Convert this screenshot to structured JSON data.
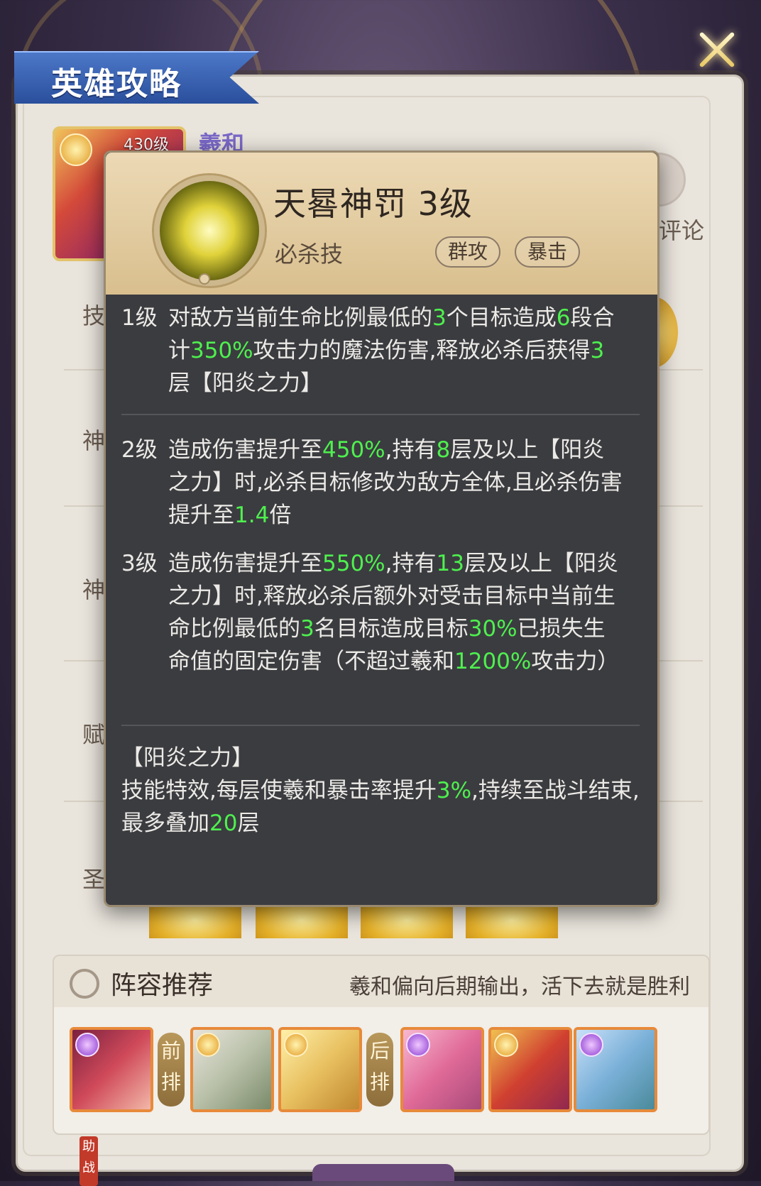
{
  "header": {
    "title": "英雄攻略",
    "close_icon": "close-icon"
  },
  "hero": {
    "level": "430级",
    "name": "羲和"
  },
  "comment": {
    "label": "评论"
  },
  "rows": [
    "技",
    "神",
    "神",
    "赋",
    "圣 装"
  ],
  "skill": {
    "name": "天晷神罚 3级",
    "type": "必杀技",
    "tags": [
      "群攻",
      "暴击"
    ],
    "levels": [
      {
        "level": "1级",
        "parts": [
          "对敌方当前生命比例最低的",
          "3",
          "个目标造成",
          "6",
          "段合计",
          "350%",
          "攻击力的魔法伤害,释放必杀后获得",
          "3",
          "层【阳炎之力】"
        ]
      },
      {
        "level": "2级",
        "parts": [
          "造成伤害提升至",
          "450%",
          ",持有",
          "8",
          "层及以上【阳炎之力】时,必杀目标修改为敌方全体,且必杀伤害提升至",
          "1.4",
          "倍"
        ]
      },
      {
        "level": "3级",
        "parts": [
          "造成伤害提升至",
          "550%",
          ",持有",
          "13",
          "层及以上【阳炎之力】时,释放必杀后额外对受击目标中当前生命比例最低的",
          "3",
          "名目标造成目标",
          "30%",
          "已损失生命值的固定伤害（不超过羲和",
          "1200%",
          "攻击力）"
        ]
      }
    ],
    "buff": {
      "title": "【阳炎之力】",
      "parts": [
        "技能特效,每层使羲和暴击率提升",
        "3%",
        ",持续至战斗结束,最多叠加",
        "20",
        "层"
      ]
    }
  },
  "lineup": {
    "title": "阵容推荐",
    "note": "羲和偏向后期输出，活下去就是胜利",
    "front_label": "前排",
    "back_label": "后排",
    "assist_label": "助战"
  },
  "colors": {
    "highlight": "#4ef04e",
    "popup_bg": "#3b3c40",
    "ribbon": "#2a4f9c"
  }
}
